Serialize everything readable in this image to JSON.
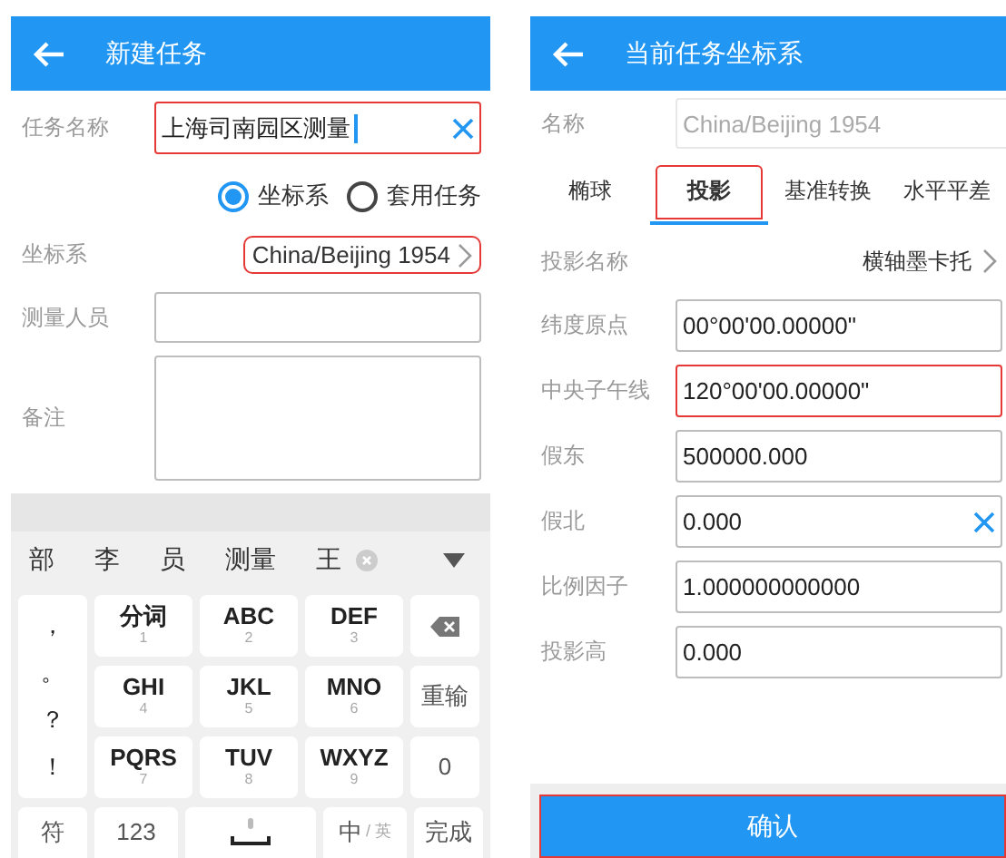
{
  "new_task": {
    "title": "新建任务",
    "task_name": {
      "label": "任务名称",
      "value": "上海司南园区测量",
      "highlighted": true,
      "focused": true
    },
    "radios": [
      {
        "label": "坐标系",
        "selected": true
      },
      {
        "label": "套用任务",
        "selected": false
      }
    ],
    "coordinate_system": {
      "label": "坐标系",
      "value": "China/Beijing 1954",
      "highlighted": true
    },
    "surveyor": {
      "label": "测量人员"
    },
    "notes": {
      "label": "备注"
    }
  },
  "keyboard": {
    "candidates": [
      "部",
      "李",
      "员",
      "测量",
      "王"
    ],
    "punctuation": [
      "，",
      "。",
      "？",
      "！"
    ],
    "keys": [
      {
        "label": "分词",
        "digit": "1"
      },
      {
        "label": "ABC",
        "digit": "2"
      },
      {
        "label": "DEF",
        "digit": "3"
      },
      {
        "kind": "backspace"
      },
      {
        "label": "GHI",
        "digit": "4"
      },
      {
        "label": "JKL",
        "digit": "5"
      },
      {
        "label": "MNO",
        "digit": "6"
      },
      {
        "kind": "text",
        "label": "重输"
      },
      {
        "label": "PQRS",
        "digit": "7"
      },
      {
        "label": "TUV",
        "digit": "8"
      },
      {
        "label": "WXYZ",
        "digit": "9"
      },
      {
        "kind": "text",
        "label": "0"
      }
    ],
    "bottom": [
      {
        "kind": "text",
        "label": "符"
      },
      {
        "kind": "text",
        "label": "123"
      },
      {
        "kind": "space"
      },
      {
        "kind": "lang",
        "label": "中",
        "sub": "/ 英"
      },
      {
        "kind": "text",
        "label": "完成"
      }
    ]
  },
  "coordinate_system": {
    "title": "当前任务坐标系",
    "name": {
      "label": "名称",
      "placeholder": "China/Beijing 1954"
    },
    "tabs": [
      {
        "label": "椭球",
        "selected": false,
        "highlighted": false
      },
      {
        "label": "投影",
        "selected": true,
        "highlighted": true
      },
      {
        "label": "基准转换",
        "selected": false,
        "highlighted": false
      },
      {
        "label": "水平平差",
        "selected": false,
        "highlighted": false
      }
    ],
    "projection_name": {
      "label": "投影名称",
      "value": "横轴墨卡托"
    },
    "params": [
      {
        "label": "纬度原点",
        "value": "00°00'00.00000\"",
        "highlighted": false,
        "clearable": false
      },
      {
        "label": "中央子午线",
        "value": "120°00'00.00000\"",
        "highlighted": true,
        "clearable": false
      },
      {
        "label": "假东",
        "value": "500000.000",
        "highlighted": false,
        "clearable": false
      },
      {
        "label": "假北",
        "value": "0.000",
        "highlighted": false,
        "clearable": true
      },
      {
        "label": "比例因子",
        "value": "1.000000000000",
        "highlighted": false,
        "clearable": false
      },
      {
        "label": "投影高",
        "value": "0.000",
        "highlighted": false,
        "clearable": false
      }
    ],
    "confirm": {
      "label": "确认",
      "highlighted": true
    }
  }
}
